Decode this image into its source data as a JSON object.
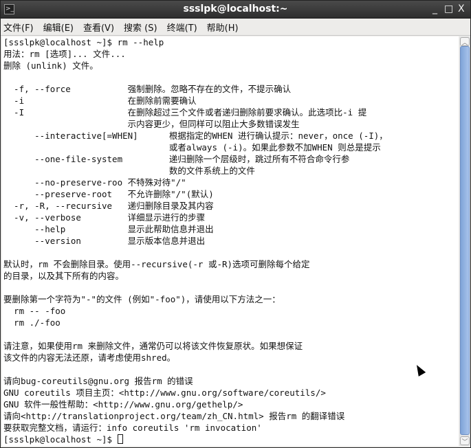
{
  "window": {
    "title": "ssslpk@localhost:~",
    "minimize": "_",
    "maximize": "□",
    "close": "X"
  },
  "menu": [
    "文件(F)",
    "编辑(E)",
    "查看(V)",
    "搜索 (S)",
    "终端(T)",
    "帮助(H)"
  ],
  "lines": [
    "[ssslpk@localhost ~]$ rm --help",
    "用法：rm [选项]... 文件...",
    "删除 (unlink) 文件。",
    "",
    "  -f, --force           强制删除。忽略不存在的文件，不提示确认",
    "  -i                    在删除前需要确认",
    "  -I                    在删除超过三个文件或者递归删除前要求确认。此选项比-i 提",
    "                        示内容更少，但同样可以阻止大多数错误发生",
    "      --interactive[=WHEN]      根据指定的WHEN 进行确认提示：never，once (-I)，",
    "                                或者always (-i)。如果此参数不加WHEN 则总是提示",
    "      --one-file-system         递归删除一个层级时，跳过所有不符合命令行参",
    "                                数的文件系统上的文件",
    "      --no-preserve-roo 不特殊对待\"/\"",
    "      --preserve-root   不允许删除\"/\"(默认)",
    "  -r, -R, --recursive   递归删除目录及其内容",
    "  -v, --verbose         详细显示进行的步骤",
    "      --help            显示此帮助信息并退出",
    "      --version         显示版本信息并退出",
    "",
    "默认时，rm 不会删除目录。使用--recursive(-r 或-R)选项可删除每个给定",
    "的目录，以及其下所有的内容。",
    "",
    "要删除第一个字符为\"-\"的文件 (例如\"-foo\")，请使用以下方法之一：",
    "  rm -- -foo",
    "  rm ./-foo",
    "",
    "请注意，如果使用rm 来删除文件，通常仍可以将该文件恢复原状。如果想保证",
    "该文件的内容无法还原，请考虑使用shred。",
    "",
    "请向bug-coreutils@gnu.org 报告rm 的错误",
    "GNU coreutils 项目主页：<http://www.gnu.org/software/coreutils/>",
    "GNU 软件一般性帮助：<http://www.gnu.org/gethelp/>",
    "请向<http://translationproject.org/team/zh_CN.html> 报告rm 的翻译错误",
    "要获取完整文档，请运行：info coreutils 'rm invocation'"
  ],
  "prompt": "[ssslpk@localhost ~]$ "
}
